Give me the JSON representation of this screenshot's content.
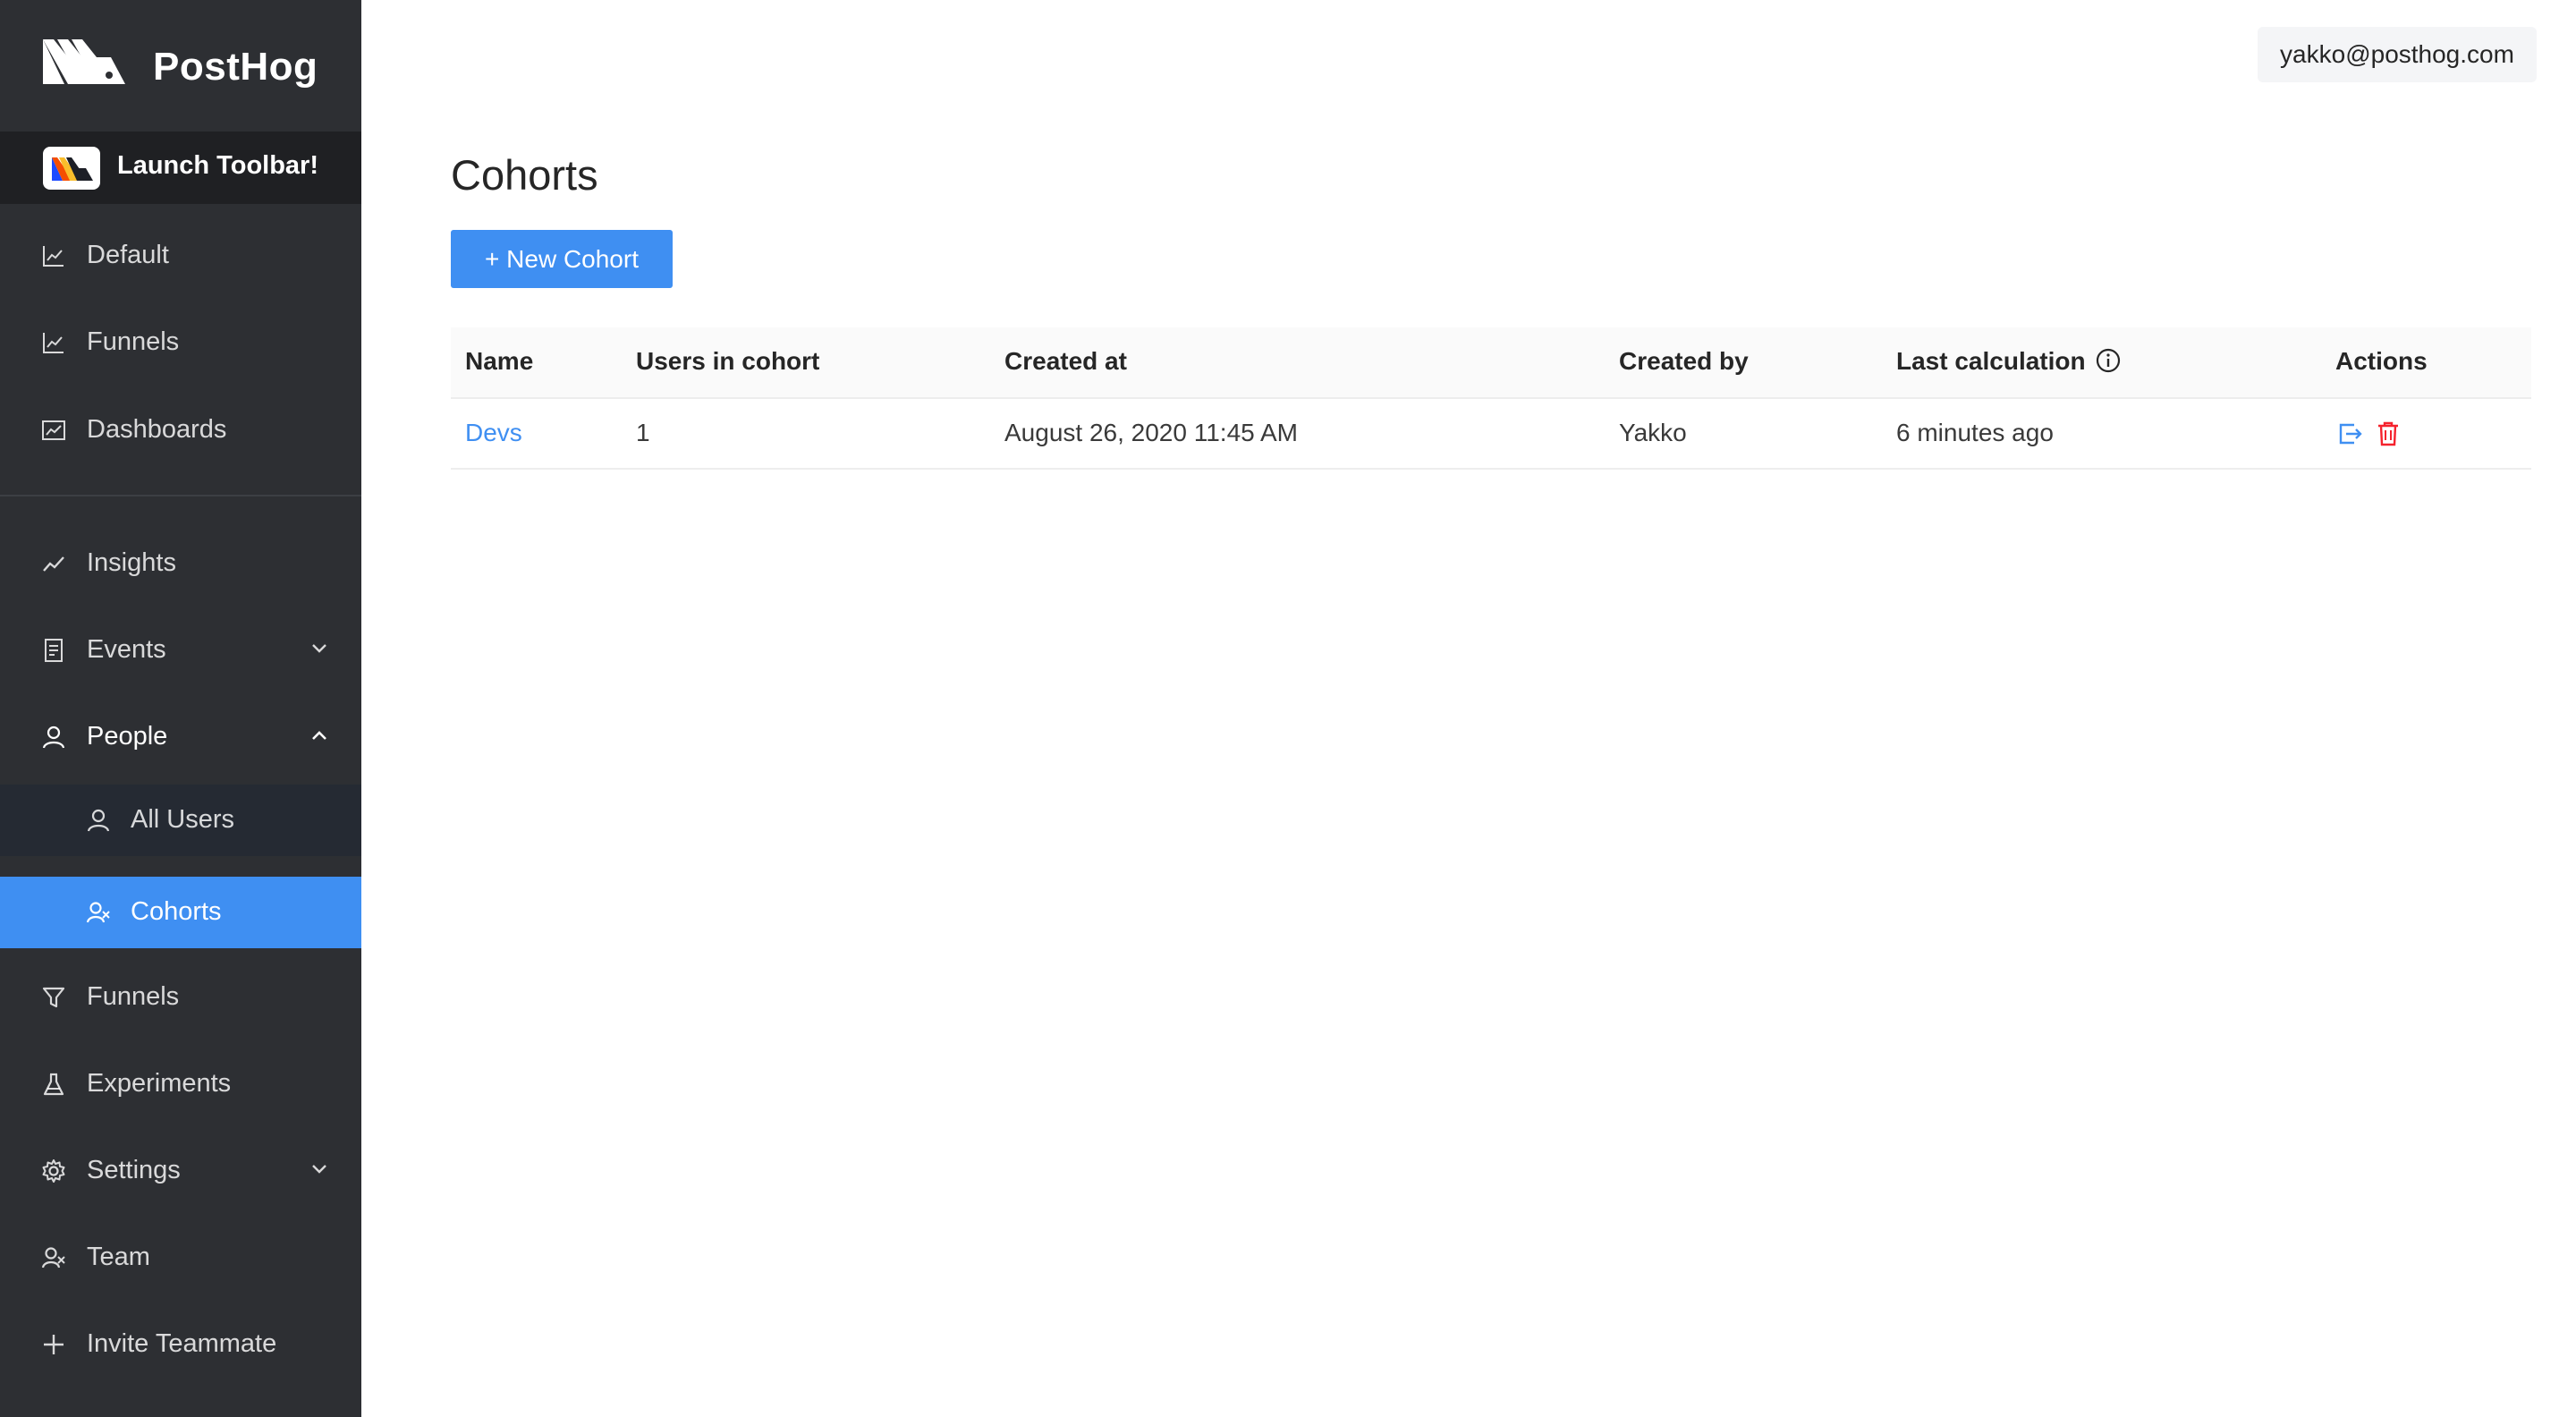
{
  "app": {
    "name": "PostHog",
    "toolbar_label": "Launch Toolbar!",
    "user_email": "yakko@posthog.com"
  },
  "sidebar": {
    "items": [
      {
        "id": "default",
        "label": "Default",
        "icon": "line-chart-icon"
      },
      {
        "id": "funnels-top",
        "label": "Funnels",
        "icon": "line-chart-icon"
      },
      {
        "id": "dashboards",
        "label": "Dashboards",
        "icon": "dashboard-icon"
      },
      {
        "id": "insights",
        "label": "Insights",
        "icon": "trend-icon"
      },
      {
        "id": "events",
        "label": "Events",
        "icon": "document-icon"
      },
      {
        "id": "people",
        "label": "People",
        "icon": "user-icon"
      },
      {
        "id": "all-users",
        "label": "All Users",
        "icon": "user-icon"
      },
      {
        "id": "cohorts",
        "label": "Cohorts",
        "icon": "team-icon"
      },
      {
        "id": "funnels",
        "label": "Funnels",
        "icon": "funnel-icon"
      },
      {
        "id": "experiments",
        "label": "Experiments",
        "icon": "flask-icon"
      },
      {
        "id": "settings",
        "label": "Settings",
        "icon": "gear-icon"
      },
      {
        "id": "team",
        "label": "Team",
        "icon": "team-icon"
      },
      {
        "id": "invite",
        "label": "Invite Teammate",
        "icon": "plus-icon"
      }
    ]
  },
  "main": {
    "title": "Cohorts",
    "new_button_label": "+ New Cohort",
    "table": {
      "columns": [
        "Name",
        "Users in cohort",
        "Created at",
        "Created by",
        "Last calculation",
        "Actions"
      ],
      "rows": [
        {
          "name": "Devs",
          "users": "1",
          "created_at": "August 26, 2020 11:45 AM",
          "created_by": "Yakko",
          "last_calculation": "6 minutes ago"
        }
      ]
    }
  },
  "colors": {
    "sidebar_bg": "#2d2f33",
    "accent": "#3f8ff2",
    "danger": "#f5222d"
  }
}
